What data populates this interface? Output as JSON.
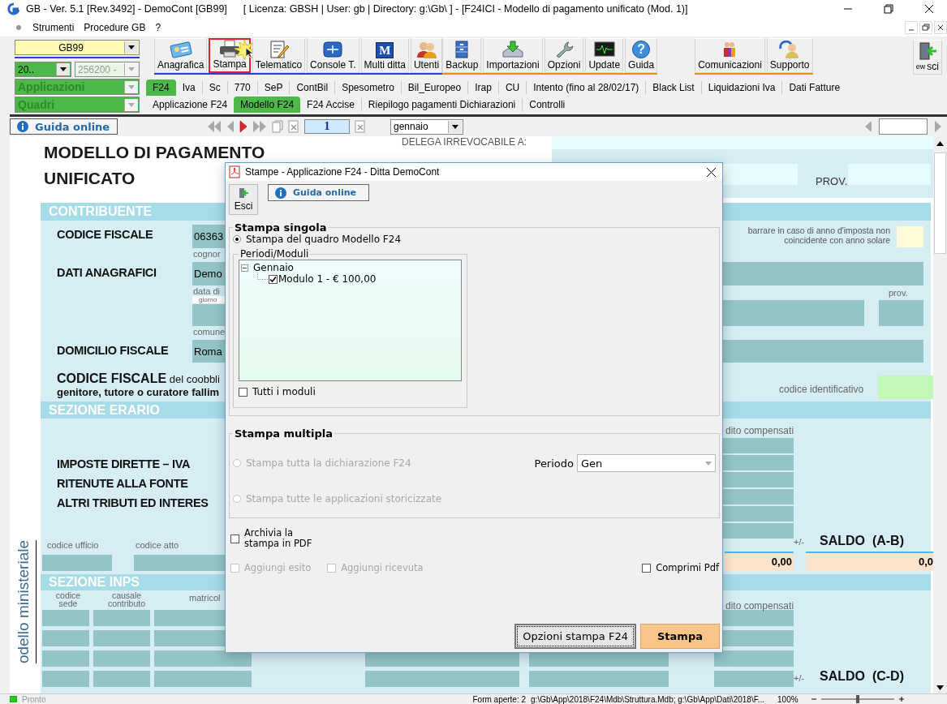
{
  "window": {
    "title": "GB - Ver. 5.1 [Rev.3492] -  DemoCont [GB99]",
    "info": "[ Licenza: GBSH | User: gb | Directory: g:\\Gb\\ ] - [F24ICI - Modello di pagamento unificato (Mod. 1)]"
  },
  "menu": [
    {
      "label": "Strumenti"
    },
    {
      "label": "Procedure GB"
    },
    {
      "label": "?"
    }
  ],
  "selectors": {
    "ditta": "GB99",
    "anno": "20..",
    "codice": "256200 -",
    "applicazioni": "Applicazioni",
    "quadri": "Quadri"
  },
  "toolbar_groups": [
    {
      "color": "#2b3fd6",
      "buttons": [
        {
          "label": "Anagrafica",
          "highlighted": false
        },
        {
          "label": "Stampa",
          "highlighted": true
        },
        {
          "label": "Telematico",
          "highlighted": false
        },
        {
          "label": "Console T.",
          "highlighted": false
        },
        {
          "label": "Multi ditta",
          "highlighted": false,
          "icon_text": "M"
        },
        {
          "label": "Utenti",
          "highlighted": false
        }
      ]
    },
    {
      "color": "#f08a24",
      "buttons": [
        {
          "label": "Backup",
          "highlighted": false
        },
        {
          "label": "Importazioni",
          "highlighted": false
        },
        {
          "label": "Opzioni",
          "highlighted": false
        },
        {
          "label": "Update",
          "highlighted": false
        },
        {
          "label": "Guida",
          "highlighted": false,
          "icon_text": "?"
        }
      ]
    },
    {
      "color": "#f08a24",
      "buttons": [
        {
          "label": "Comunicazioni",
          "highlighted": false
        },
        {
          "label": "Supporto",
          "highlighted": false
        }
      ]
    }
  ],
  "exit_button": {
    "label": "sci",
    "overlap": "ew"
  },
  "tabs": [
    {
      "label": "F24",
      "selected": true
    },
    {
      "label": "Iva",
      "selected": false
    },
    {
      "label": "Sc",
      "selected": false
    },
    {
      "label": "770",
      "selected": false
    },
    {
      "label": "SeP",
      "selected": false
    },
    {
      "label": "ContBil",
      "selected": false
    },
    {
      "label": "Spesometro",
      "selected": false
    },
    {
      "label": "Bil_Europeo",
      "selected": false
    },
    {
      "label": "Irap",
      "selected": false
    },
    {
      "label": "CU",
      "selected": false
    },
    {
      "label": "Intento (fino al 28/02/17)",
      "selected": false
    },
    {
      "label": "Black List",
      "selected": false
    },
    {
      "label": "Liquidazioni Iva",
      "selected": false
    },
    {
      "label": "Dati Fatture",
      "selected": false
    }
  ],
  "subtabs": [
    {
      "label": "Applicazione F24",
      "selected": false
    },
    {
      "label": "Modello F24",
      "selected": true
    },
    {
      "label": "F24 Accise",
      "selected": false
    },
    {
      "label": "Riepilogo pagamenti Dichiarazioni",
      "selected": false
    },
    {
      "label": "Controlli",
      "selected": false
    }
  ],
  "navbar": {
    "help": "Guida online",
    "page": "1",
    "month": "gennaio"
  },
  "form": {
    "title_lines": [
      "MODELLO DI PAGAMENTO",
      "UNIFICATO"
    ],
    "delega": "DELEGA IRREVOCABILE A:",
    "prov_label": "PROV.",
    "sections": [
      "CONTRIBUENTE",
      "SEZIONE ERARIO",
      "SEZIONE INPS"
    ],
    "contribuente": {
      "cf_label": "CODICE FISCALE",
      "cf": "06363",
      "cognome_caption": "cognor",
      "dati_label": "DATI ANAGRAFICI",
      "cognome": "Demo",
      "data_caption": "data di",
      "giorno_caption": "giorno",
      "comune_caption": "comune",
      "domicilio_label": "DOMICILIO FISCALE",
      "domicilio": "Roma",
      "coobbligato_lines": [
        "**CODICE FISCALE** del coobbli",
        "genitore, tutore o curatore fallim"
      ],
      "anno_note": "barrare in caso di anno d'imposta non coincidente con anno solare",
      "prov_caption": "prov.",
      "id_caption": "codice identificativo"
    },
    "erario": {
      "labels": [
        "IMPOSTE DIRETTE – IVA",
        "RITENUTE ALLA FONTE",
        "ALTRI TRIBUTI ED INTERES"
      ],
      "credit_caption": "dito compensati",
      "sign": "+/-",
      "saldo": "SALDO  (A-B)",
      "ufficio_caption": "codice ufficio",
      "atto_caption": "codice atto",
      "totals": [
        "0,00",
        "0,0"
      ]
    },
    "inps": {
      "captions": [
        "codice sede",
        "causale contributo",
        "matricol"
      ],
      "credit_caption": "dito compensati",
      "sign": "+/-",
      "saldo": "SALDO  (C-D)"
    },
    "side_label": "odello ministeriale"
  },
  "dialog": {
    "title": "Stampe - Applicazione F24 - Ditta  DemoCont",
    "exit": "Esci",
    "help": "Guida online",
    "single": {
      "legend": "Stampa singola",
      "radio": {
        "label": "Stampa del quadro Modello F24",
        "selected": true
      },
      "periods_legend": "Periodi/Moduli",
      "tree": [
        {
          "label": "Gennaio",
          "expanded": true,
          "children": [
            {
              "label": "Modulo 1 - € 100,00",
              "checked": true
            }
          ]
        }
      ],
      "all": {
        "label": "Tutti i moduli",
        "checked": false
      }
    },
    "multiple": {
      "legend": "Stampa multipla",
      "radios": [
        {
          "label": "Stampa tutta la dichiarazione F24",
          "selected": false,
          "disabled": true
        },
        {
          "label": "Stampa tutte le applicazioni storicizzate",
          "selected": false,
          "disabled": true
        }
      ],
      "period_label": "Periodo",
      "period": "Gen"
    },
    "archive": {
      "label": "Archivia la stampa in PDF",
      "checked": false,
      "disabled": false
    },
    "options": [
      {
        "label": "Aggiungi esito",
        "checked": false,
        "disabled": true
      },
      {
        "label": "Aggiungi ricevuta",
        "checked": false,
        "disabled": true
      },
      {
        "label": "Comprimi Pdf",
        "checked": false,
        "disabled": false
      }
    ],
    "buttons": [
      {
        "label": "Opzioni stampa F24",
        "kind": "default"
      },
      {
        "label": "Stampa",
        "kind": "primary"
      }
    ]
  },
  "status_bar": {
    "state": "Pronto",
    "forms": "Form aperte: 2",
    "path": "g:\\Gb\\App\\2018\\F24\\Mdb\\Struttura.Mdb; g:\\Gb\\App\\Dati\\2018\\F...",
    "zoom": "100%",
    "zoom_slider": {
      "level": 0.5
    }
  }
}
